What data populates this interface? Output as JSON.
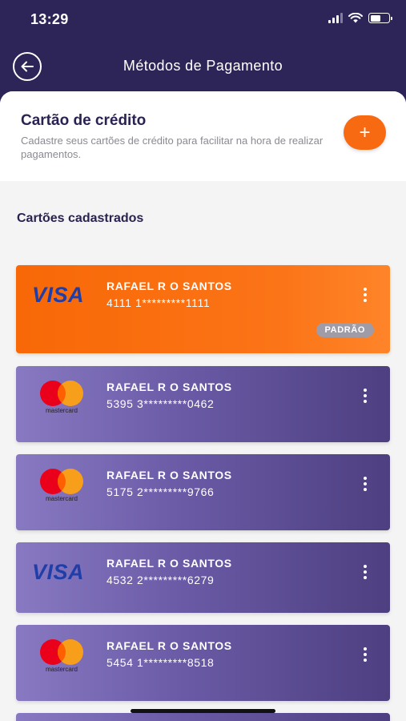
{
  "status_bar": {
    "time": "13:29"
  },
  "nav": {
    "title": "Métodos de Pagamento"
  },
  "credit": {
    "title": "Cartão de crédito",
    "description": "Cadastre seus cartões de crédito para facilitar na hora de realizar pagamentos.",
    "add_label": "+"
  },
  "section_title": "Cartões cadastrados",
  "cards": [
    {
      "brand": "VISA",
      "holder": "RAFAEL R O SANTOS",
      "number": "4111 1*********1111",
      "badge": "PADRÃO"
    },
    {
      "brand": "mastercard",
      "holder": "RAFAEL R O SANTOS",
      "number": "5395 3*********0462"
    },
    {
      "brand": "mastercard",
      "holder": "RAFAEL R O SANTOS",
      "number": "5175 2*********9766"
    },
    {
      "brand": "VISA",
      "holder": "RAFAEL R O SANTOS",
      "number": "4532 2*********6279"
    },
    {
      "brand": "mastercard",
      "holder": "RAFAEL R O SANTOS",
      "number": "5454 1*********8518"
    }
  ],
  "colors": {
    "header_bg": "#2d2558",
    "accent_orange": "#f86a12",
    "card_purple": "#6a5aa6",
    "badge_grey": "#9f9ca8"
  },
  "icons": {
    "back": "arrow-left-icon",
    "add": "plus-icon",
    "menu": "more-vertical-icon",
    "wifi": "wifi-icon",
    "signal": "signal-icon",
    "battery": "battery-icon"
  }
}
